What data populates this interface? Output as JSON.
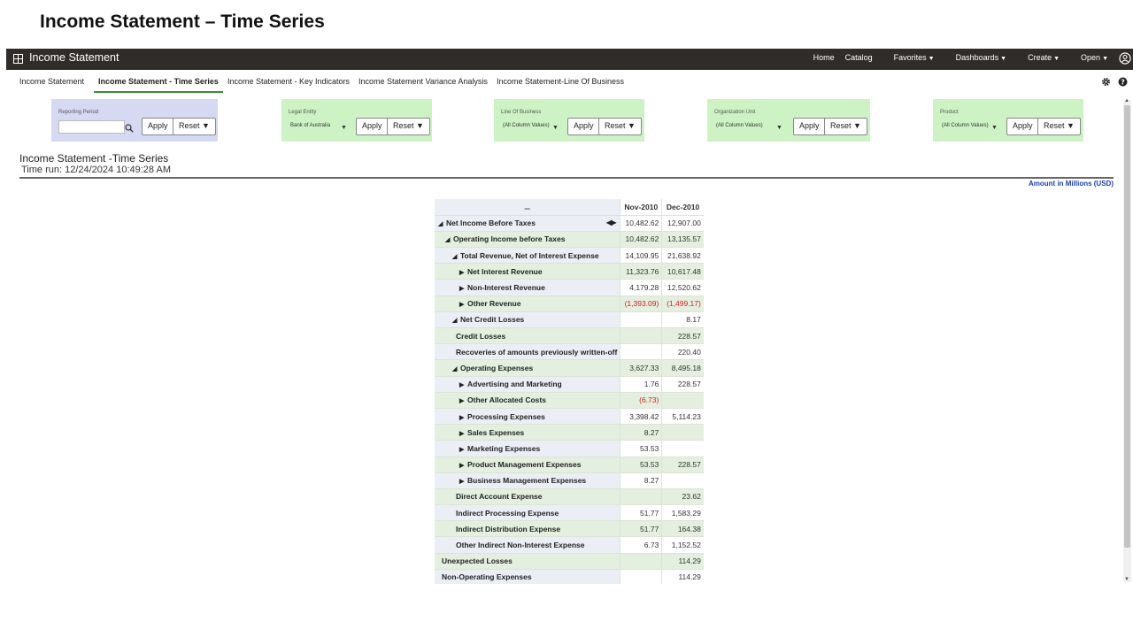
{
  "slide_title": "Income Statement – Time Series",
  "app": {
    "title": "Income Statement",
    "nav": [
      "Home",
      "Catalog",
      "Favorites",
      "Dashboards",
      "Create",
      "Open"
    ]
  },
  "tabs": [
    "Income Statement",
    "Income Statement - Time Series",
    "Income Statement - Key Indicators",
    "Income Statement Variance Analysis",
    "Income Statement-Line Of Business"
  ],
  "prompts": {
    "reporting_period": {
      "label": "Reporting Period",
      "value": "",
      "bg": "#d6d9f2"
    },
    "legal_entity": {
      "label": "Legal Entity",
      "value": "Bank of Australia",
      "bg": "#cdf2c4"
    },
    "line_of_business": {
      "label": "Line Of Business",
      "value": "(All Column Values)",
      "bg": "#cdf2c4"
    },
    "organization_unit": {
      "label": "Organization Unit",
      "value": "(All Column Values)",
      "bg": "#cdf2c4"
    },
    "product": {
      "label": "Product",
      "value": "(All Column Values)",
      "bg": "#cdf2c4"
    },
    "apply_label": "Apply",
    "reset_label": "Reset ▼"
  },
  "report": {
    "title": "Income Statement -Time Series",
    "time_run": "Time run: 12/24/2024 10:49:28 AM",
    "amount_note": "Amount in Millions (USD)",
    "columns": [
      "Nov-2010",
      "Dec-2010"
    ],
    "rows": [
      {
        "label": "Net Income Before Taxes",
        "nov": "10,482.62",
        "dec": "12,907.00"
      },
      {
        "label": "Operating Income before Taxes",
        "nov": "10,482.62",
        "dec": "13,135.57"
      },
      {
        "label": "Total Revenue, Net of Interest Expense",
        "nov": "14,109.95",
        "dec": "21,638.92"
      },
      {
        "label": "Net Interest Revenue",
        "nov": "11,323.76",
        "dec": "10,617.48"
      },
      {
        "label": "Non-Interest Revenue",
        "nov": "4,179.28",
        "dec": "12,520.62"
      },
      {
        "label": "Other Revenue",
        "nov": "(1,393.09)",
        "dec": "(1,499.17)"
      },
      {
        "label": "Net Credit Losses",
        "nov": "",
        "dec": "8.17"
      },
      {
        "label": "Credit Losses",
        "nov": "",
        "dec": "228.57"
      },
      {
        "label": "Recoveries of amounts previously written-off",
        "nov": "",
        "dec": "220.40"
      },
      {
        "label": "Operating Expenses",
        "nov": "3,627.33",
        "dec": "8,495.18"
      },
      {
        "label": "Advertising and Marketing",
        "nov": "1.76",
        "dec": "228.57"
      },
      {
        "label": "Other Allocated Costs",
        "nov": "(6.73)",
        "dec": ""
      },
      {
        "label": "Processing Expenses",
        "nov": "3,398.42",
        "dec": "5,114.23"
      },
      {
        "label": "Sales Expenses",
        "nov": "8.27",
        "dec": ""
      },
      {
        "label": "Marketing Expenses",
        "nov": "53.53",
        "dec": ""
      },
      {
        "label": "Product Management Expenses",
        "nov": "53.53",
        "dec": "228.57"
      },
      {
        "label": "Business Management Expenses",
        "nov": "8.27",
        "dec": ""
      },
      {
        "label": "Direct Account Expense",
        "nov": "",
        "dec": "23.62"
      },
      {
        "label": "Indirect Processing Expense",
        "nov": "51.77",
        "dec": "1,583.29"
      },
      {
        "label": "Indirect Distribution Expense",
        "nov": "51.77",
        "dec": "164.38"
      },
      {
        "label": "Other Indirect Non-Interest Expense",
        "nov": "6.73",
        "dec": "1,152.52"
      },
      {
        "label": "Unexpected Losses",
        "nov": "",
        "dec": "114.29"
      },
      {
        "label": "Non-Operating Expenses",
        "nov": "",
        "dec": "114.29"
      }
    ]
  },
  "colors": {
    "topbar": "#302c29",
    "accent_green": "#3b8a3b",
    "negative": "#d32020",
    "link_blue": "#1f3fb5"
  }
}
